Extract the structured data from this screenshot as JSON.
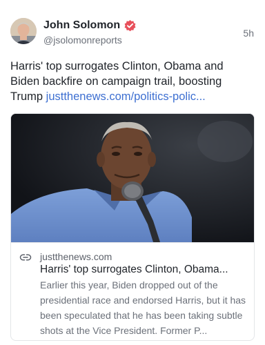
{
  "author": {
    "name": "John Solomon",
    "handle": "@jsolomonreports",
    "verified_icon": "verified-badge-icon",
    "verified_color": "#e8505b",
    "avatar_icon": "avatar"
  },
  "post": {
    "timestamp": "5h",
    "text": "Harris' top surrogates Clinton, Obama and Biden backfire on campaign trail, boosting Trump ",
    "link_text": "justthenews.com/politics-polic...",
    "link_color": "#3d6fd1"
  },
  "preview": {
    "image_icon": "article-photo",
    "link_icon": "link-icon",
    "domain": "justthenews.com",
    "title": "Harris' top surrogates Clinton, Obama...",
    "description": "Earlier this year, Biden dropped out of the presidential race and endorsed Harris, but it has been speculated that he has been taking subtle shots at the Vice President. Former P..."
  }
}
